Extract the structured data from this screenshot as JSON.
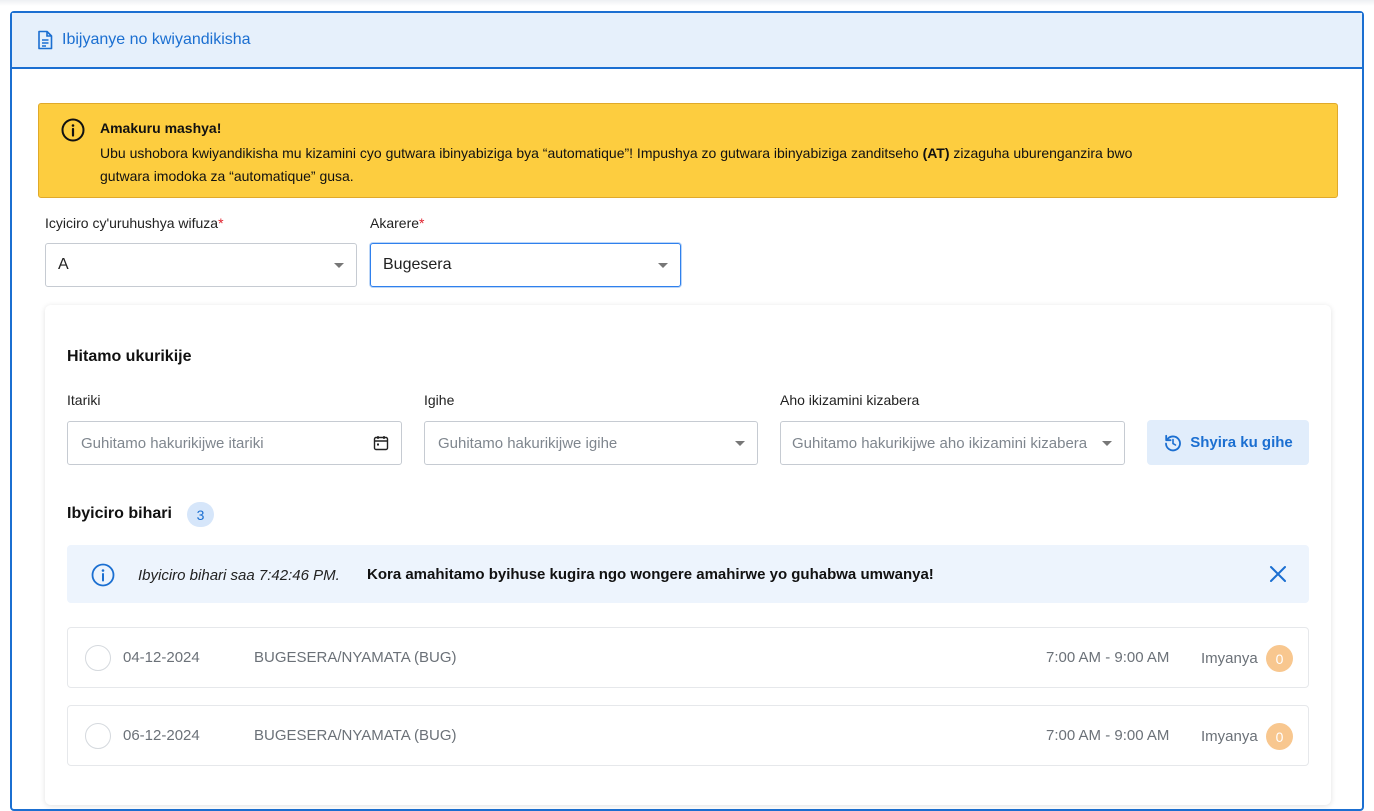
{
  "panel": {
    "title": "Ibijyanye no kwiyandikisha",
    "icon": "document-icon"
  },
  "alert": {
    "icon": "info-icon",
    "title": "Amakuru mashya!",
    "body_part1": "Ubu ushobora kwiyandikisha mu kizamini cyo gutwara ibinyabiziga bya “automatique”! Impushya zo gutwara ibinyabiziga zanditseho ",
    "body_bold": "(AT)",
    "body_part2": " zizaguha uburenganzira bwo gutwara imodoka za “automatique” gusa."
  },
  "form": {
    "category_label": "Icyiciro cy'uruhushya wifuza",
    "category_value": "A",
    "district_label": "Akarere",
    "district_value": "Bugesera",
    "required_mark": "*"
  },
  "schedule": {
    "title": "Hitamo ukurikije",
    "date_label": "Itariki",
    "date_placeholder": "Guhitamo hakurikijwe itariki",
    "time_label": "Igihe",
    "time_placeholder": "Guhitamo hakurikijwe igihe",
    "location_label": "Aho ikizamini kizabera",
    "location_placeholder": "Guhitamo hakurikijwe aho ikizamini kizabera",
    "refresh_label": "Shyira ku gihe"
  },
  "slots": {
    "title": "Ibyiciro bihari",
    "count": "3",
    "note_italic": "Ibyiciro bihari saa 7:42:46 PM.",
    "note_bold": "Kora amahitamo byihuse kugira ngo wongere amahirwe yo guhabwa umwanya!",
    "items": [
      {
        "date": "04-12-2024",
        "place": "BUGESERA/NYAMATA (BUG)",
        "time": "7:00 AM - 9:00 AM",
        "seats_label": "Imyanya",
        "seats": "0"
      },
      {
        "date": "06-12-2024",
        "place": "BUGESERA/NYAMATA (BUG)",
        "time": "7:00 AM - 9:00 AM",
        "seats_label": "Imyanya",
        "seats": "0"
      }
    ]
  },
  "colors": {
    "accent": "#1b6fd1",
    "alert_bg": "#fdcd3f",
    "badge_orange": "#f8c78f"
  }
}
